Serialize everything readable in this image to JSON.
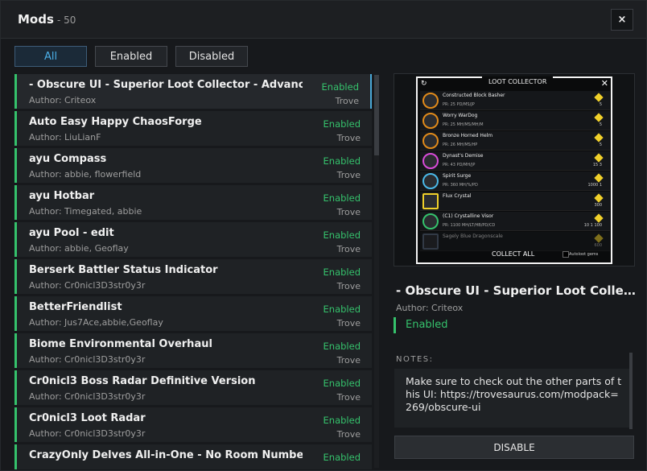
{
  "window": {
    "title": "Mods",
    "count": "- 50",
    "close_label": "×"
  },
  "filters": [
    {
      "label": "All",
      "active": true
    },
    {
      "label": "Enabled",
      "active": false
    },
    {
      "label": "Disabled",
      "active": false
    }
  ],
  "mods": [
    {
      "name": "- Obscure UI - Superior Loot Collector - Advanced",
      "author": "Author: Criteox",
      "status": "Enabled",
      "source": "Trove",
      "selected": true
    },
    {
      "name": "Auto Easy Happy ChaosForge",
      "author": "Author: LiuLianF",
      "status": "Enabled",
      "source": "Trove"
    },
    {
      "name": "ayu Compass",
      "author": "Author: abbie, flowerfield",
      "status": "Enabled",
      "source": "Trove"
    },
    {
      "name": "ayu Hotbar",
      "author": "Author: Timegated, abbie",
      "status": "Enabled",
      "source": "Trove"
    },
    {
      "name": "ayu Pool - edit",
      "author": "Author: abbie, Geoflay",
      "status": "Enabled",
      "source": "Trove"
    },
    {
      "name": "Berserk Battler Status Indicator",
      "author": "Author: Cr0nicl3D3str0y3r",
      "status": "Enabled",
      "source": "Trove"
    },
    {
      "name": "BetterFriendlist",
      "author": "Author: Jus7Ace,abbie,Geoflay",
      "status": "Enabled",
      "source": "Trove"
    },
    {
      "name": "Biome Environmental Overhaul",
      "author": "Author: Cr0nicl3D3str0y3r",
      "status": "Enabled",
      "source": "Trove"
    },
    {
      "name": "Cr0nicl3 Boss Radar Definitive Version",
      "author": "Author: Cr0nicl3D3str0y3r",
      "status": "Enabled",
      "source": "Trove"
    },
    {
      "name": "Cr0nicl3 Loot Radar",
      "author": "Author: Cr0nicl3D3str0y3r",
      "status": "Enabled",
      "source": "Trove"
    },
    {
      "name": "CrazyOnly Delves All-in-One - No Room Numbers",
      "author": "",
      "status": "Enabled",
      "source": ""
    }
  ],
  "preview": {
    "header": "LOOT COLLECTOR",
    "rows": [
      {
        "name": "Constructed Block Basher",
        "stat": "PR: 25    PD/MS/JP",
        "num": "5"
      },
      {
        "name": "Worry WarDog",
        "stat": "PR: 25    MH/MS/MH/M",
        "num": "5"
      },
      {
        "name": "Bronze Horned Helm",
        "stat": "PR: 26    MH/MS/HP",
        "num": "5"
      },
      {
        "name": "Dynast's Demise",
        "stat": "PR: 43    PD/MH/JP",
        "num": "15   3"
      },
      {
        "name": "Spirit Surge",
        "stat": "PR: 360   MH/%/PD",
        "num": "1000   1"
      },
      {
        "name": "Flux Crystal",
        "stat": "",
        "num": "300"
      },
      {
        "name": "(C1) Crystalline Visor",
        "stat": "PR: 1100  MH/LT/HB/PD/CD",
        "num": "10   1   100"
      },
      {
        "name": "Sagely Blue Dragonscale",
        "stat": "",
        "num": "600"
      }
    ],
    "collect_label": "COLLECT ALL",
    "autoloot_label": "Autoloot gems"
  },
  "detail": {
    "title": "- Obscure UI - Superior Loot Collector - Advanced",
    "author": "Author: Criteox",
    "status": "Enabled",
    "notes_label": "NOTES:",
    "notes": "Make sure to check out the other parts of this UI: https://trovesaurus.com/modpack=269/obscure-ui",
    "disable_label": "DISABLE"
  },
  "colors": {
    "accent_blue": "#4cb0e8",
    "enabled_green": "#35c26c",
    "background_stripe": "#c9b21a"
  }
}
